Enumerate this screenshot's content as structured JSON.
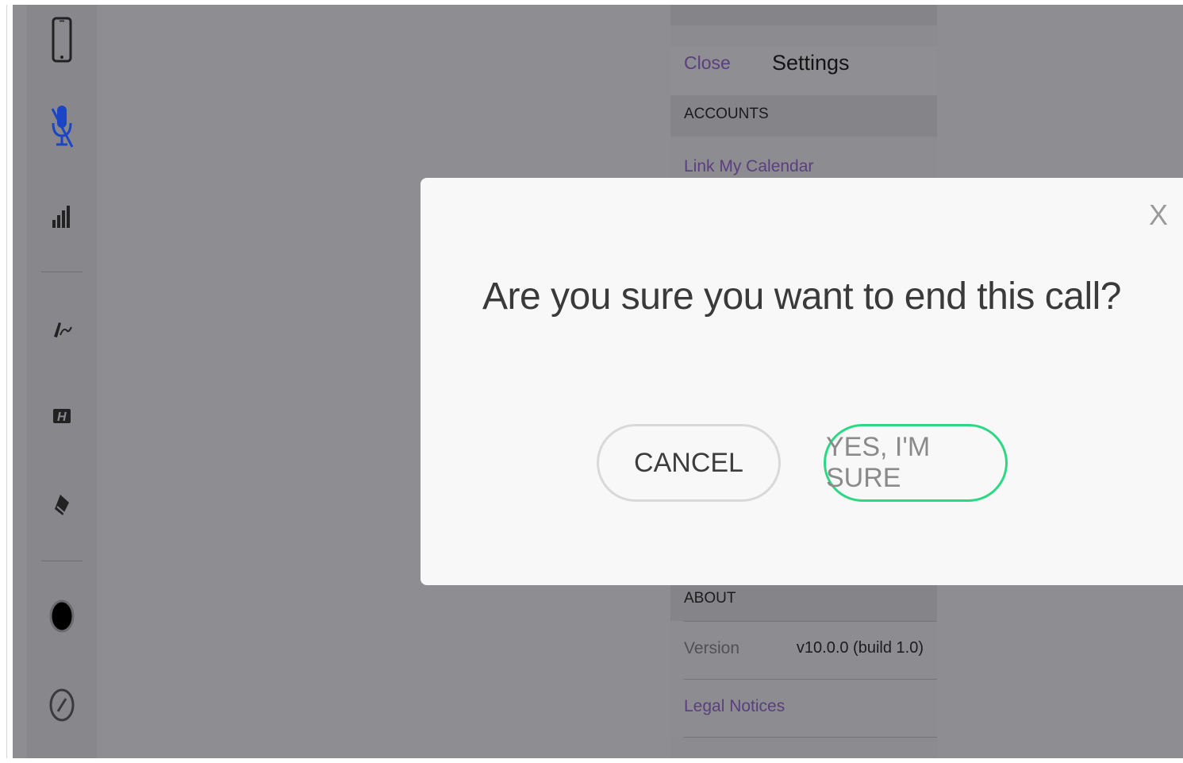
{
  "settings": {
    "nav": {
      "close_label": "Close",
      "title": "Settings"
    },
    "accounts_header": "ACCOUNTS",
    "link_calendar": "Link My Calendar",
    "about_header": "ABOUT",
    "version_label": "Version",
    "version_value": "v10.0.0 (build 1.0)",
    "legal_notices": "Legal Notices"
  },
  "modal": {
    "close_glyph": "X",
    "question": "Are you sure you want to end this call?",
    "cancel_label": "CANCEL",
    "confirm_label": "YES, I'M SURE"
  },
  "rail": {
    "icons": [
      "phone-icon",
      "microphone-muted-icon",
      "signal-bars-icon",
      "signature-pen-icon",
      "highlighter-icon",
      "eraser-icon",
      "color-dot-icon",
      "pencil-circle-icon"
    ]
  },
  "colors": {
    "accent_purple": "#5a3f7e",
    "confirm_green": "#2dd783",
    "mic_blue": "#1a45c7",
    "overlay_gray": "#8e8d92"
  }
}
